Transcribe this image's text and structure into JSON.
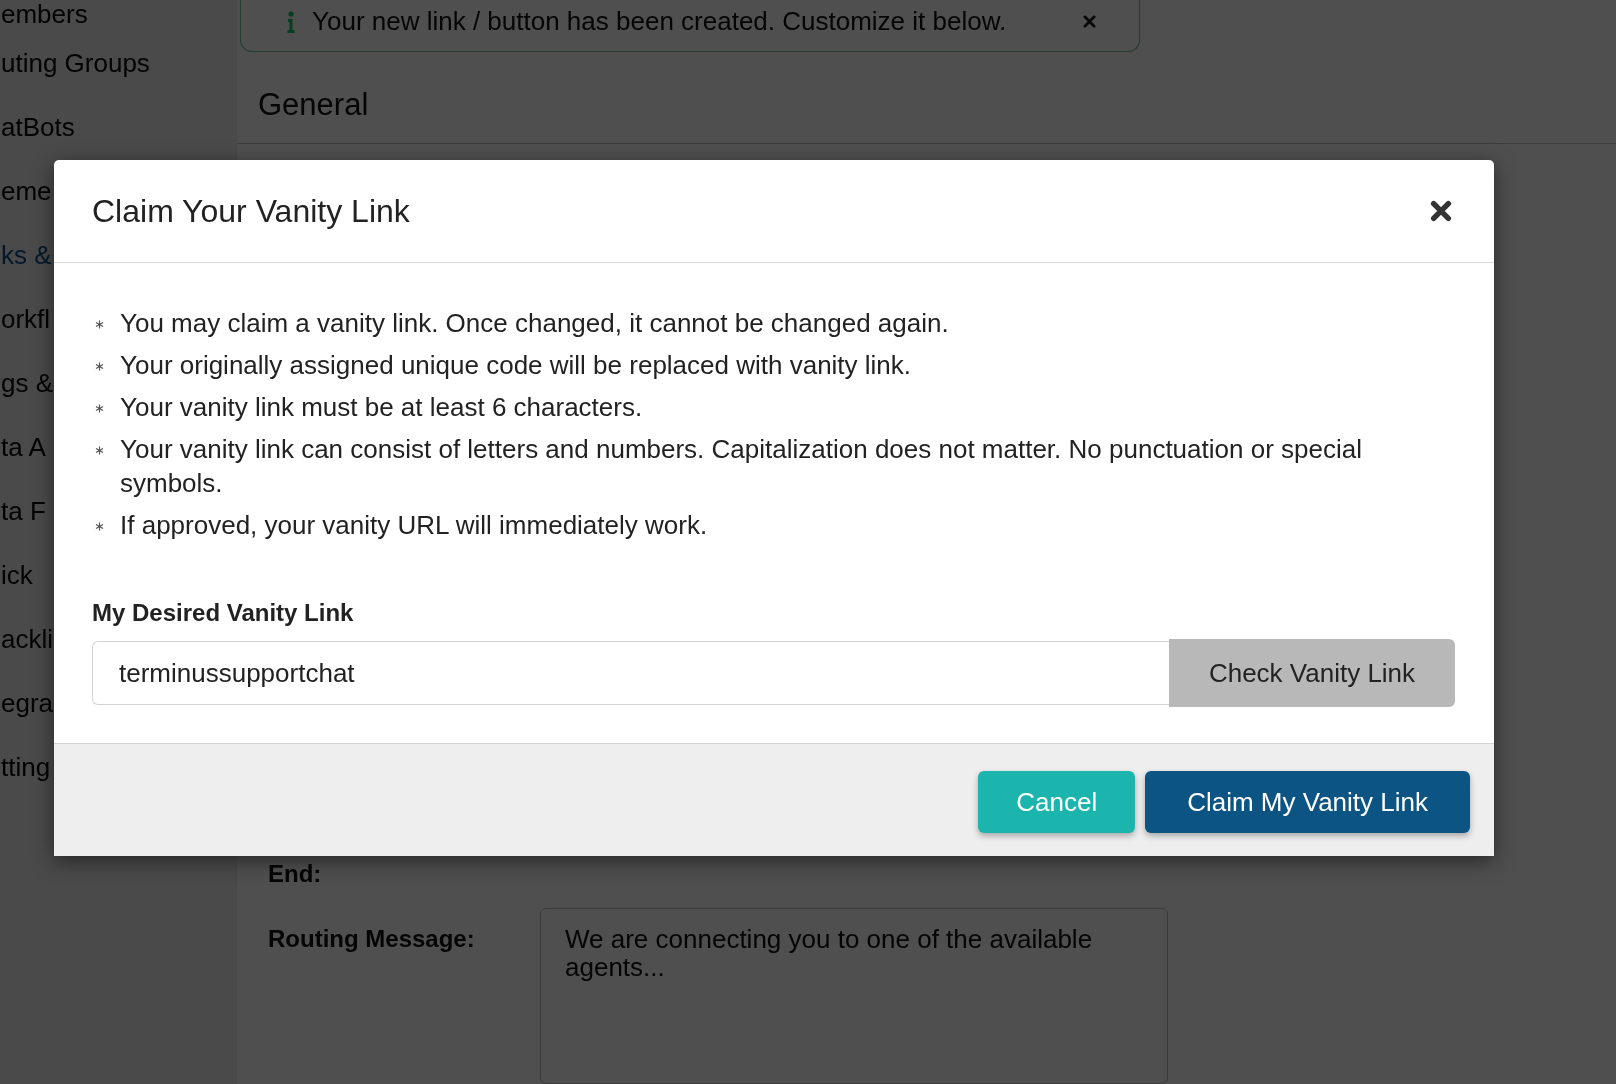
{
  "sidebar": {
    "items": [
      {
        "label": "embers",
        "selected": false
      },
      {
        "label": "uting Groups",
        "selected": false
      },
      {
        "label": "atBots",
        "selected": false
      },
      {
        "label": "eme",
        "selected": false
      },
      {
        "label": "ks &",
        "selected": true
      },
      {
        "label": "orkfl",
        "selected": false
      },
      {
        "label": "gs &",
        "selected": false
      },
      {
        "label": "ta A",
        "selected": false
      },
      {
        "label": "ta F",
        "selected": false
      },
      {
        "label": "ick",
        "selected": false
      },
      {
        "label": "ackli",
        "selected": false
      },
      {
        "label": "egra",
        "selected": false
      },
      {
        "label": "tting",
        "selected": false
      }
    ]
  },
  "alert": {
    "text": "Your new link / button has been created. Customize it below."
  },
  "section": {
    "title": "General"
  },
  "form_fields": [
    {
      "label": "End:"
    },
    {
      "label": "Routing Message:",
      "value": "We are connecting you to one of the available agents..."
    }
  ],
  "modal": {
    "title": "Claim Your Vanity Link",
    "rules": [
      "You may claim a vanity link. Once changed, it cannot be changed again.",
      "Your originally assigned unique code will be replaced with vanity link.",
      "Your vanity link must be at least 6 characters.",
      "Your vanity link can consist of letters and numbers. Capitalization does not matter. No punctuation or special symbols.",
      "If approved, your vanity URL will immediately work."
    ],
    "field": {
      "label": "My Desired Vanity Link",
      "value": "terminussupportchat",
      "button": "Check Vanity Link"
    },
    "buttons": [
      {
        "label": "Cancel",
        "kind": "secondary"
      },
      {
        "label": "Claim My Vanity Link",
        "kind": "primary"
      }
    ]
  }
}
